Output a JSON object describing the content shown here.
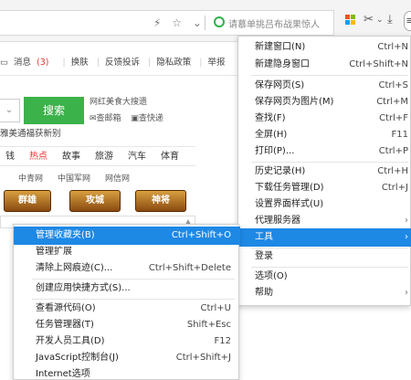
{
  "toolbar": {
    "search_hint": "请慕单挑吕布战果惊人",
    "menu_button_glyph": "≡"
  },
  "page": {
    "nav": {
      "msg": "消息",
      "msg_count": "(3)",
      "skin": "换肤",
      "feedback": "反馈投诉",
      "privacy": "隐私政策",
      "report": "举报"
    },
    "search_button": "搜索",
    "hint_title": "网红美食大搜遗",
    "mail1": "✉查邮箱",
    "mail2": "▣查快递",
    "cut_text": "雅美通福获新别",
    "categories": [
      "钱",
      "热点",
      "故事",
      "旅游",
      "汽车",
      "体育"
    ],
    "links": [
      "中青网",
      "中国军网",
      "网信网"
    ],
    "games": [
      "群雄",
      "攻城",
      "神将"
    ]
  },
  "menu": {
    "items": [
      {
        "label": "新建窗口(N)",
        "shortcut": "Ctrl+N"
      },
      {
        "label": "新建隐身窗口",
        "shortcut": "Ctrl+Shift+N"
      },
      {
        "label": "保存网页(S)",
        "shortcut": "Ctrl+S"
      },
      {
        "label": "保存网页为图片(M)",
        "shortcut": "Ctrl+M"
      },
      {
        "label": "查找(F)",
        "shortcut": "Ctrl+F"
      },
      {
        "label": "全屏(H)",
        "shortcut": "F11"
      },
      {
        "label": "打印(P)...",
        "shortcut": "Ctrl+P"
      },
      {
        "label": "历史记录(H)",
        "shortcut": "Ctrl+H"
      },
      {
        "label": "下载任务管理(D)",
        "shortcut": "Ctrl+J"
      },
      {
        "label": "设置界面样式(U)",
        "shortcut": ""
      },
      {
        "label": "代理服务器",
        "shortcut": ""
      },
      {
        "label": "工具",
        "shortcut": ""
      },
      {
        "label": "登录",
        "shortcut": ""
      },
      {
        "label": "选项(O)",
        "shortcut": ""
      },
      {
        "label": "帮助",
        "shortcut": ""
      }
    ]
  },
  "submenu": {
    "items": [
      {
        "label": "管理收藏夹(B)",
        "shortcut": "Ctrl+Shift+O"
      },
      {
        "label": "管理扩展",
        "shortcut": ""
      },
      {
        "label": "清除上网痕迹(C)...",
        "shortcut": "Ctrl+Shift+Delete"
      },
      {
        "label": "创建应用快捷方式(S)...",
        "shortcut": ""
      },
      {
        "label": "查看源代码(O)",
        "shortcut": "Ctrl+U"
      },
      {
        "label": "任务管理器(T)",
        "shortcut": "Shift+Esc"
      },
      {
        "label": "开发人员工具(D)",
        "shortcut": "F12"
      },
      {
        "label": "JavaScript控制台(J)",
        "shortcut": "Ctrl+Shift+J"
      },
      {
        "label": "Internet选项",
        "shortcut": ""
      }
    ]
  },
  "colors": {
    "accent": "#1e88e5",
    "search_green": "#3cb24a",
    "hot_red": "#e33333"
  }
}
